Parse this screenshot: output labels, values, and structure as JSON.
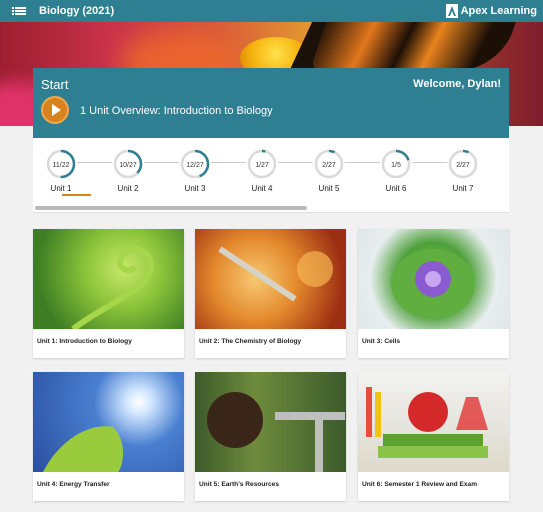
{
  "header": {
    "title": "Biology (2021)",
    "brand": "Apex Learning"
  },
  "start": {
    "label": "Start",
    "welcome": "Welcome, Dylan!",
    "overview": "1  Unit Overview:  Introduction to Biology"
  },
  "units": [
    {
      "name": "Unit 1",
      "progress": "11/22",
      "fraction": 0.5
    },
    {
      "name": "Unit 2",
      "progress": "10/27",
      "fraction": 0.37
    },
    {
      "name": "Unit 3",
      "progress": "12/27",
      "fraction": 0.44
    },
    {
      "name": "Unit 4",
      "progress": "1/27",
      "fraction": 0.04
    },
    {
      "name": "Unit 5",
      "progress": "2/27",
      "fraction": 0.07
    },
    {
      "name": "Unit 6",
      "progress": "1/5",
      "fraction": 0.2
    },
    {
      "name": "Unit 7",
      "progress": "2/27",
      "fraction": 0.07
    }
  ],
  "cards": [
    {
      "caption": "Unit 1: Introduction to Biology"
    },
    {
      "caption": "Unit 2: The Chemistry of Biology"
    },
    {
      "caption": "Unit 3: Cells"
    },
    {
      "caption": "Unit 4: Energy Transfer"
    },
    {
      "caption": "Unit 5: Earth's Resources"
    },
    {
      "caption": "Unit 6: Semester 1 Review and Exam"
    }
  ],
  "colors": {
    "header": "#2f7f92",
    "accent": "#d9831f",
    "ring": "#2f7f92",
    "ring_track": "#d9d9d9"
  }
}
